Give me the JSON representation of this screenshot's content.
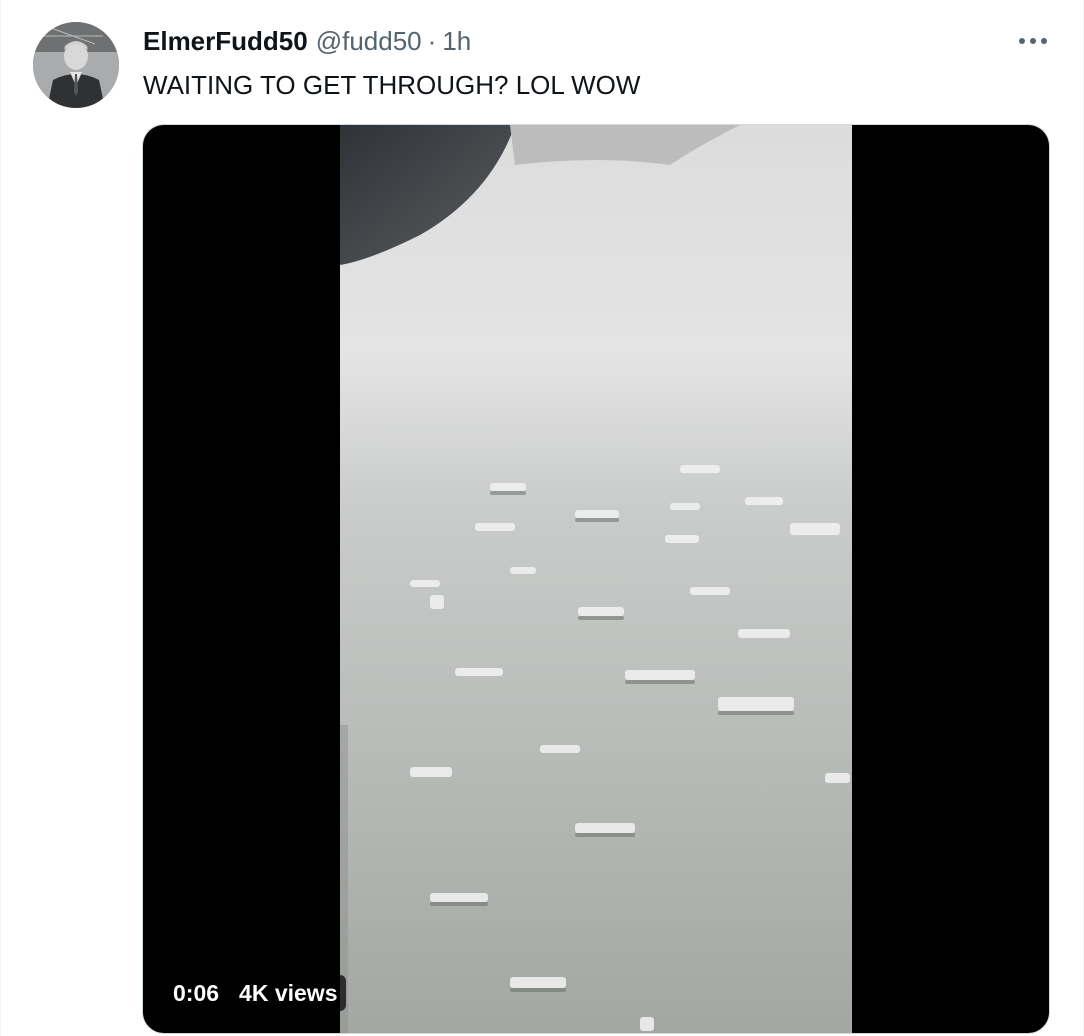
{
  "tweet": {
    "display_name": "ElmerFudd50",
    "handle": "@fudd50",
    "separator": "·",
    "time": "1h",
    "text": "WAITING TO GET THROUGH? LOL WOW",
    "avatar_icon": "user-avatar-photo",
    "more_icon": "more-horizontal-icon"
  },
  "media": {
    "type": "video",
    "duration": "0:06",
    "views": "4K views"
  },
  "colors": {
    "name": "#0f1419",
    "secondary": "#536471",
    "media_bg": "#000000",
    "border": "#cfd9de"
  }
}
